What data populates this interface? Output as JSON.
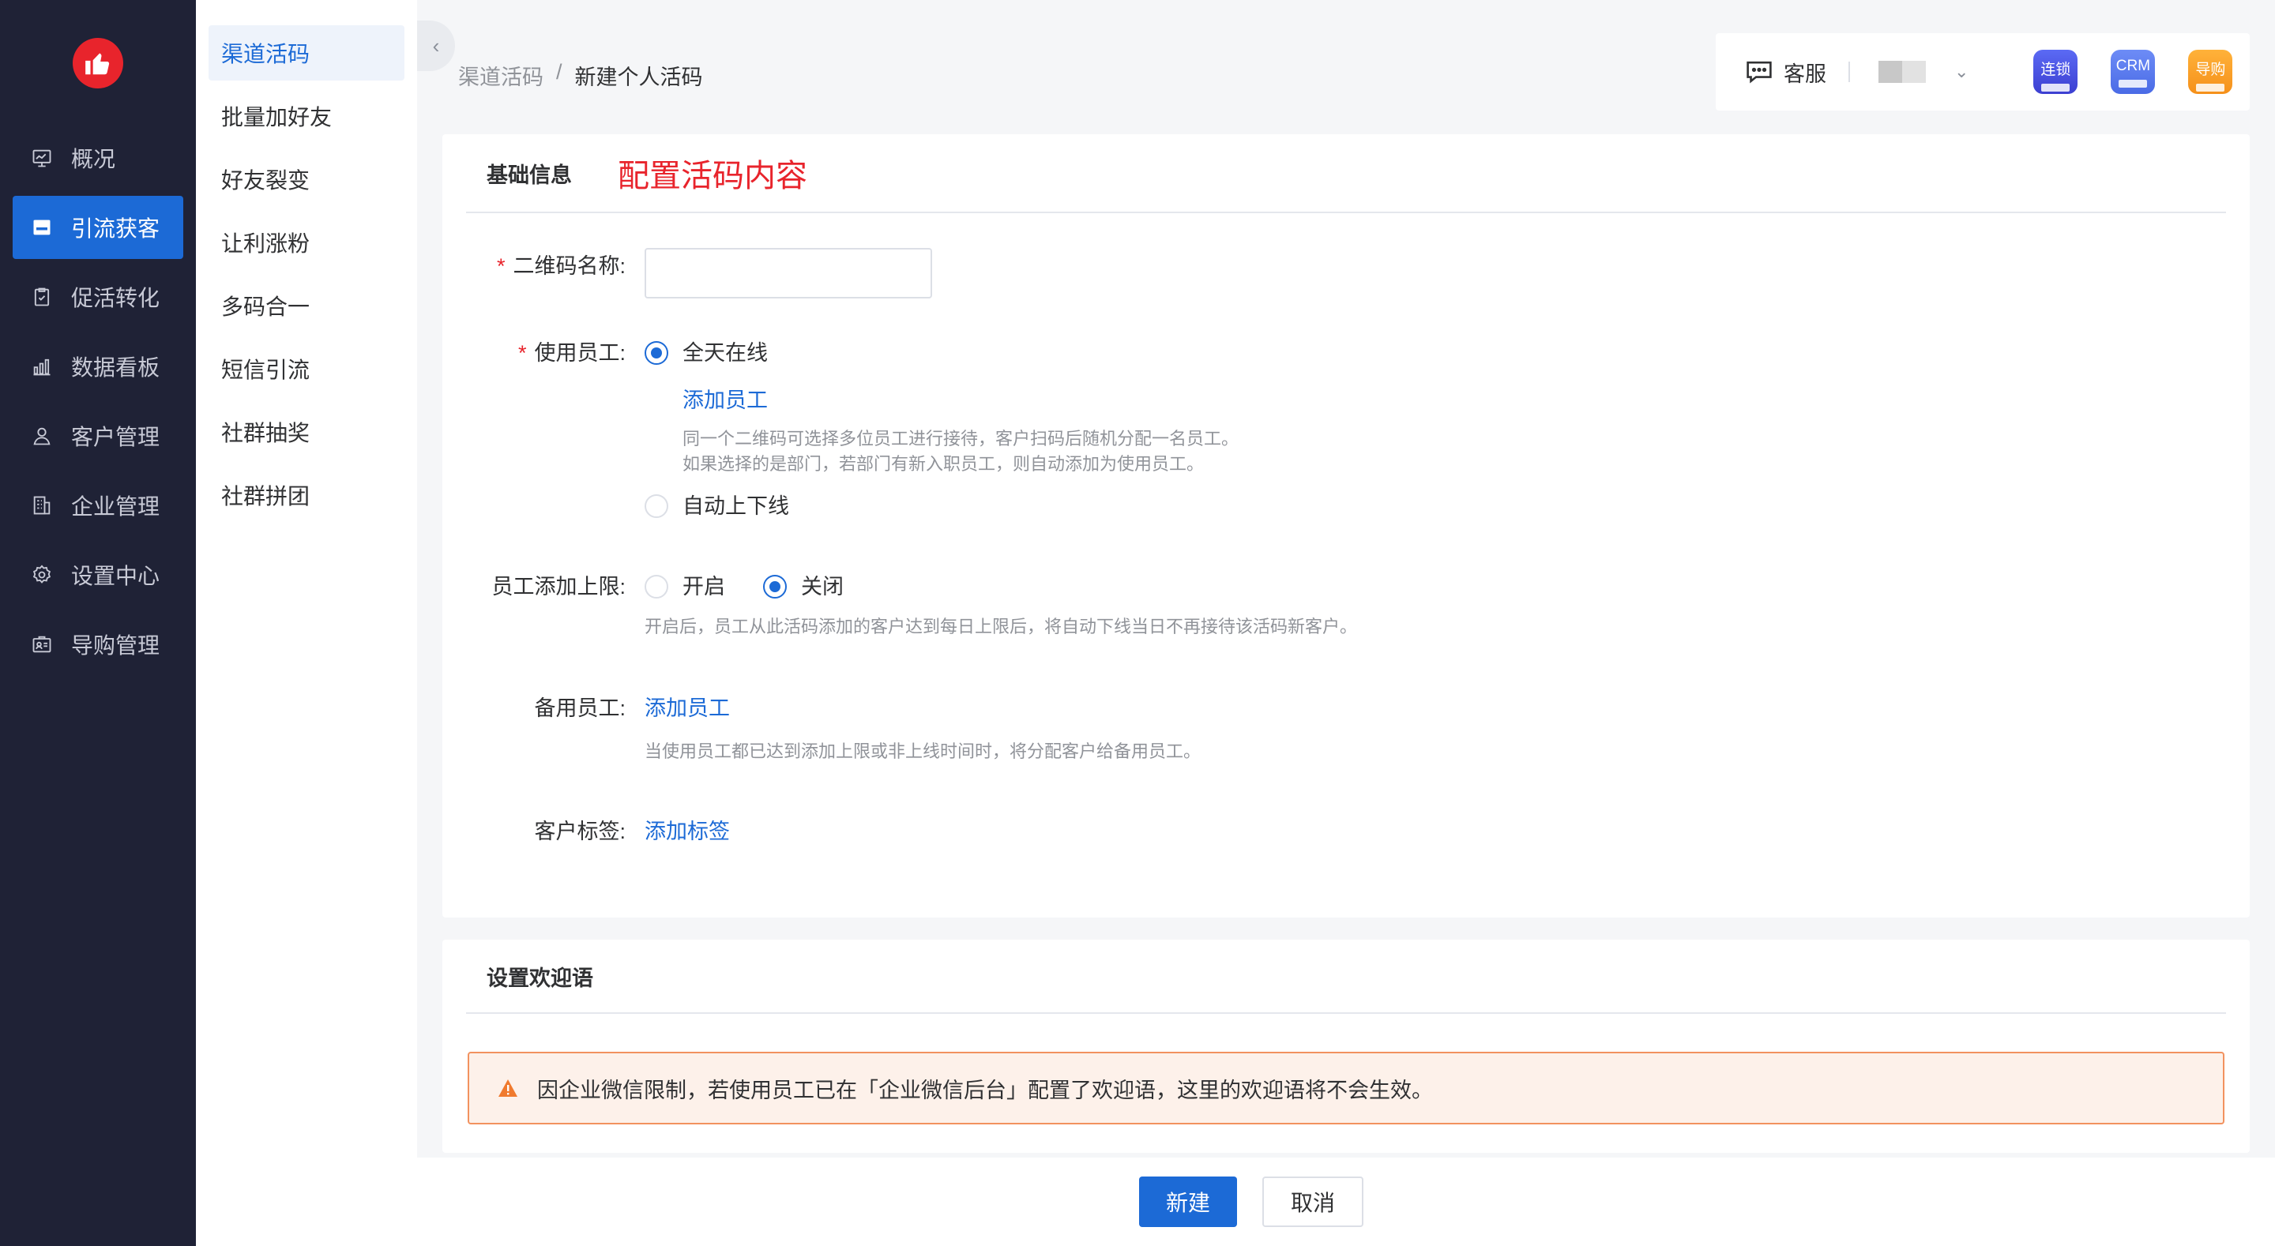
{
  "sidebar": {
    "items": [
      {
        "label": "概况",
        "icon": "monitor-chart-icon"
      },
      {
        "label": "引流获客",
        "icon": "store-icon"
      },
      {
        "label": "促活转化",
        "icon": "clipboard-icon"
      },
      {
        "label": "数据看板",
        "icon": "bar-chart-icon"
      },
      {
        "label": "客户管理",
        "icon": "user-icon"
      },
      {
        "label": "企业管理",
        "icon": "building-icon"
      },
      {
        "label": "设置中心",
        "icon": "gear-icon"
      },
      {
        "label": "导购管理",
        "icon": "id-card-icon"
      }
    ],
    "active_index": 1
  },
  "submenu": {
    "items": [
      "渠道活码",
      "批量加好友",
      "好友裂变",
      "让利涨粉",
      "多码合一",
      "短信引流",
      "社群抽奖",
      "社群拼团"
    ],
    "active_index": 0
  },
  "breadcrumb": {
    "parent": "渠道活码",
    "separator": "/",
    "current": "新建个人活码"
  },
  "topbar": {
    "service_label": "客服",
    "apps": [
      {
        "label": "连锁",
        "icon": "chain-store-icon"
      },
      {
        "label": "CRM",
        "icon": "crm-icon"
      },
      {
        "label": "导购",
        "icon": "guide-icon"
      }
    ]
  },
  "basic": {
    "title": "基础信息",
    "annotation": "配置活码内容",
    "qr_name_label": "二维码名称:",
    "qr_name_value": "",
    "staff_label": "使用员工:",
    "staff_opt_allday": "全天在线",
    "add_staff_link": "添加员工",
    "staff_hint_1": "同一个二维码可选择多位员工进行接待，客户扫码后随机分配一名员工。",
    "staff_hint_2": "如果选择的是部门，若部门有新入职员工，则自动添加为使用员工。",
    "staff_opt_auto": "自动上下线",
    "limit_label": "员工添加上限:",
    "limit_on": "开启",
    "limit_off": "关闭",
    "limit_hint": "开启后，员工从此活码添加的客户达到每日上限后，将自动下线当日不再接待该活码新客户。",
    "backup_label": "备用员工:",
    "backup_link": "添加员工",
    "backup_hint": "当使用员工都已达到添加上限或非上线时间时，将分配客户给备用员工。",
    "tag_label": "客户标签:",
    "tag_link": "添加标签"
  },
  "welcome": {
    "title": "设置欢迎语",
    "warning": "因企业微信限制，若使用员工已在「企业微信后台」配置了欢迎语，这里的欢迎语将不会生效。"
  },
  "footer": {
    "create": "新建",
    "cancel": "取消"
  },
  "colors": {
    "primary": "#1c6ad6",
    "danger": "#e8242c",
    "sidebar_bg": "#1f2236",
    "warning_border": "#f2925f"
  }
}
